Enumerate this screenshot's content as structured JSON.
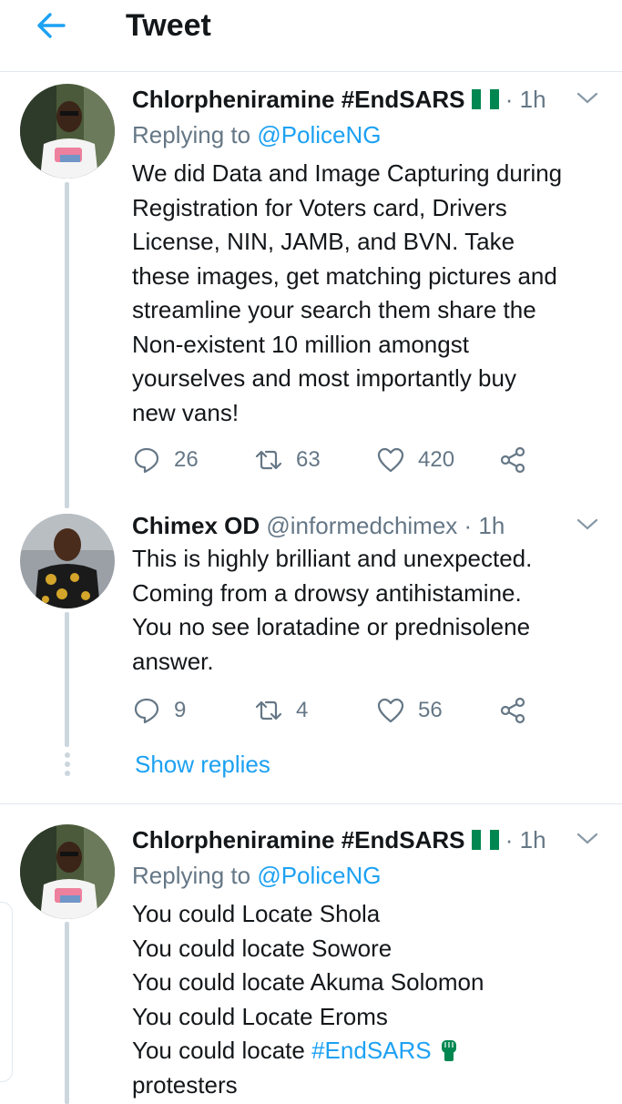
{
  "header": {
    "title": "Tweet"
  },
  "tweets": [
    {
      "name": "Chlorpheniramine #EndSARS",
      "time": "· 1h",
      "replying_prefix": "Replying to ",
      "replying_handle": "@PoliceNG",
      "lines": [
        "We did Data and Image Capturing during",
        "Registration for Voters card, Drivers",
        "License, NIN, JAMB, and BVN. Take",
        "these images, get matching pictures and",
        "streamline your search them share the",
        "Non-existent 10 million amongst",
        "yourselves and most importantly buy",
        "new vans!"
      ],
      "replies": "26",
      "retweets": "63",
      "likes": "420"
    },
    {
      "name": "Chimex OD",
      "handle": "@informedchimex",
      "time": "· 1h",
      "lines": [
        "This is highly brilliant and unexpected.",
        "Coming from a drowsy antihistamine.",
        "You no see loratadine or prednisolene",
        "answer."
      ],
      "replies": "9",
      "retweets": "4",
      "likes": "56"
    },
    {
      "name": "Chlorpheniramine #EndSARS",
      "time": "· 1h",
      "replying_prefix": "Replying to ",
      "replying_handle": "@PoliceNG",
      "lines": [
        "You could Locate Shola",
        "You could locate Sowore",
        "You could locate Akuma Solomon",
        "You could Locate Eroms"
      ],
      "line5_prefix": "You could locate ",
      "line5_hashtag": "#EndSARS",
      "line6": "protesters"
    }
  ],
  "show_replies": "Show replies",
  "colors": {
    "accent": "#1da1f2",
    "muted": "#657786",
    "text": "#14171a",
    "flag_green": "#008751"
  }
}
